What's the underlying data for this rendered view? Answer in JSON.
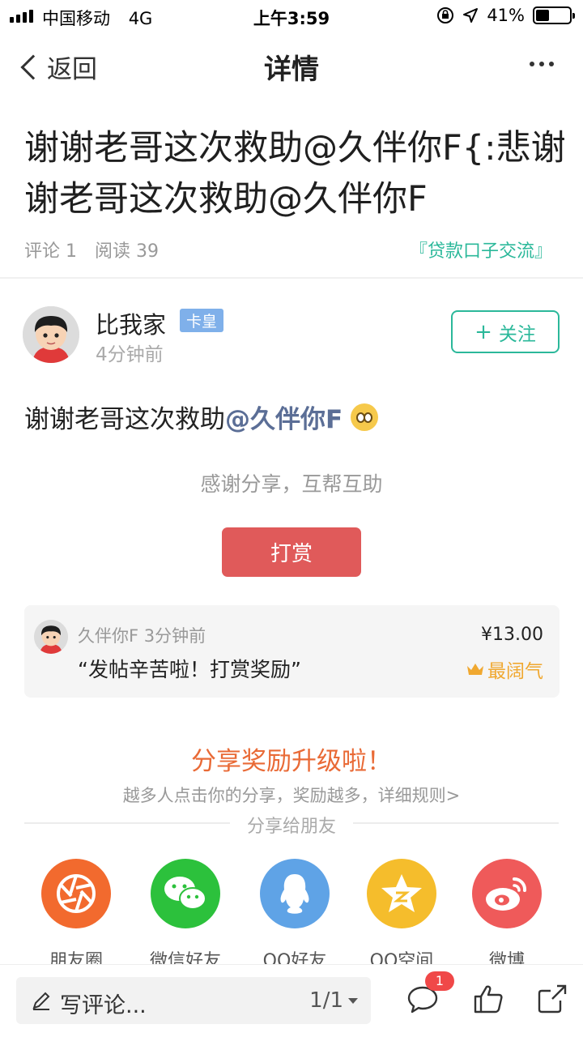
{
  "status_bar": {
    "carrier": "中国移动",
    "network": "4G",
    "time": "上午3:59",
    "battery_text": "41%",
    "battery_level": 0.41
  },
  "navbar": {
    "back_label": "返回",
    "title": "详情"
  },
  "post": {
    "title": "谢谢老哥这次救助@久伴你F{:悲谢谢老哥这次救助@久伴你F",
    "comments_label": "评论 1",
    "reads_label": "阅读 39",
    "category": "『贷款口子交流』"
  },
  "author": {
    "name": "比我家",
    "badge": "卡皇",
    "time": "4分钟前",
    "follow_label": "关注"
  },
  "body": {
    "text": "谢谢老哥这次救助",
    "mention": "@久伴你F"
  },
  "reward": {
    "prompt": "感谢分享，互帮互助",
    "button_label": "打赏",
    "record": {
      "name": "久伴你F",
      "time": "3分钟前",
      "quote": "“发帖辛苦啦！打赏奖励”",
      "amount": "¥13.00",
      "rank": "最阔气"
    }
  },
  "share": {
    "title": "分享奖励升级啦！",
    "subtitle": "越多人点击你的分享，奖励越多，详细规则>",
    "divider_label": "分享给朋友",
    "targets": [
      {
        "label": "朋友圈",
        "icon": "moments-icon",
        "color": "#f26a2e"
      },
      {
        "label": "微信好友",
        "icon": "wechat-icon",
        "color": "#2cc13c"
      },
      {
        "label": "QQ好友",
        "icon": "qq-icon",
        "color": "#5fa3e6"
      },
      {
        "label": "QQ空间",
        "icon": "qzone-icon",
        "color": "#f5bd2c"
      },
      {
        "label": "微博",
        "icon": "weibo-icon",
        "color": "#ef5a5a"
      }
    ]
  },
  "bottom_bar": {
    "comment_placeholder": "写评论...",
    "pager": "1/1",
    "comment_count": "1"
  }
}
